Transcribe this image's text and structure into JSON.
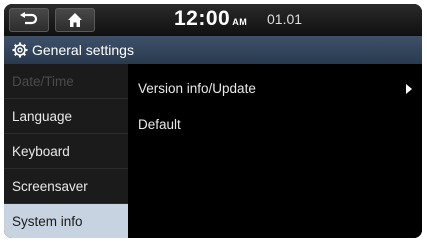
{
  "header": {
    "time": "12:00",
    "ampm": "AM",
    "date": "01.01",
    "back_icon": "back-arrow-icon",
    "home_icon": "home-icon"
  },
  "title_bar": {
    "title": "General settings",
    "icon": "gear-icon"
  },
  "sidebar": {
    "items": [
      {
        "label": "Date/Time",
        "state": "disabled"
      },
      {
        "label": "Language",
        "state": "normal"
      },
      {
        "label": "Keyboard",
        "state": "normal"
      },
      {
        "label": "Screensaver",
        "state": "normal"
      },
      {
        "label": "System info",
        "state": "selected"
      }
    ]
  },
  "content": {
    "items": [
      {
        "label": "Version info/Update",
        "has_arrow": true
      },
      {
        "label": "Default",
        "has_arrow": false
      }
    ]
  },
  "colors": {
    "title_bar": "#33465c",
    "selected_item": "#c8d3e2",
    "background": "#000000"
  }
}
